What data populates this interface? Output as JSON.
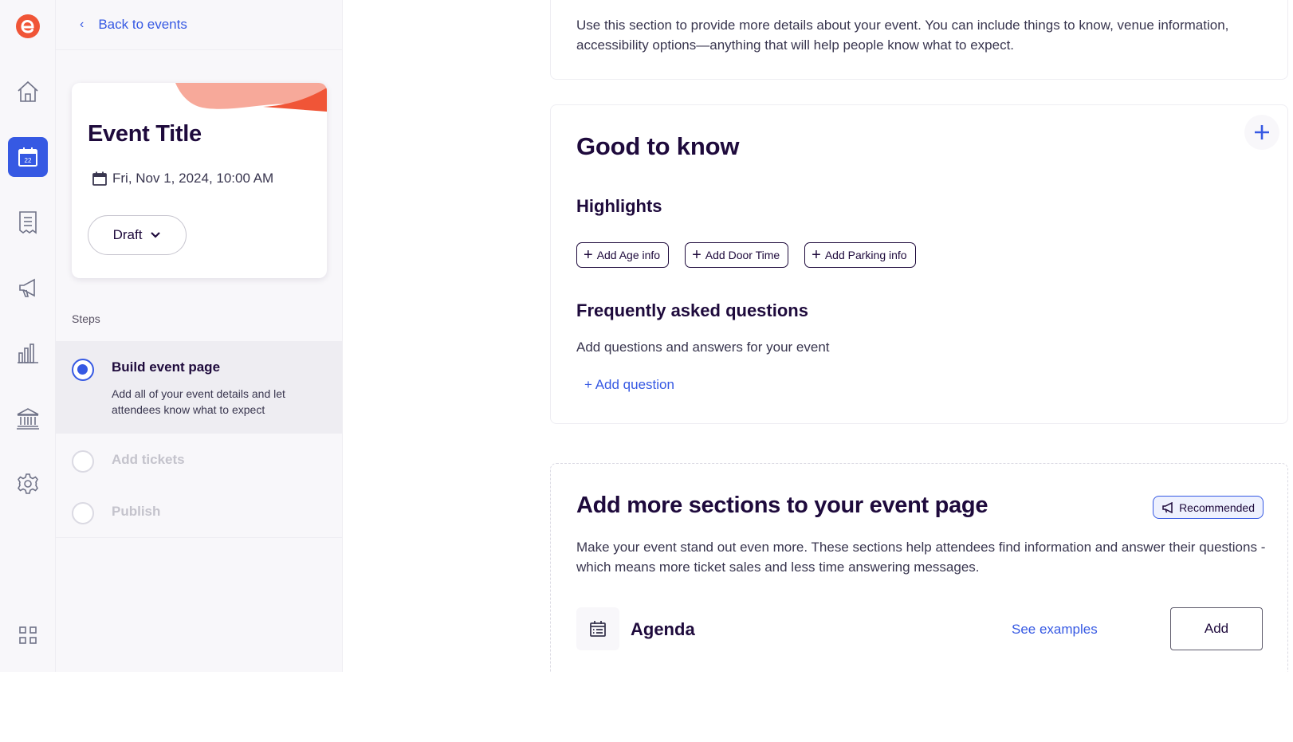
{
  "nav": {
    "back_label": "Back to events",
    "calendar_day": "22",
    "icons": [
      "logo-icon",
      "home-icon",
      "calendar-icon",
      "orders-icon",
      "marketing-icon",
      "reports-icon",
      "finance-icon",
      "settings-icon",
      "apps-grid-icon"
    ]
  },
  "event_card": {
    "title": "Event Title",
    "date": "Fri, Nov 1, 2024, 10:00 AM",
    "status": "Draft"
  },
  "steps": {
    "label": "Steps",
    "items": [
      {
        "name": "Build event page",
        "desc": "Add all of your event details and let attendees know what to expect"
      },
      {
        "name": "Add tickets"
      },
      {
        "name": "Publish"
      }
    ]
  },
  "overview": {
    "text": "Use this section to provide more details about your event. You can include things to know, venue information, accessibility options—anything that will help people know what to expect."
  },
  "good_to_know": {
    "title": "Good to know",
    "highlights_label": "Highlights",
    "chips": [
      "Add Age info",
      "Add Door Time",
      "Add Parking info"
    ],
    "faq_label": "Frequently asked questions",
    "faq_desc": "Add questions and answers for your event",
    "add_question": "+ Add question"
  },
  "more_sections": {
    "title": "Add more sections to your event page",
    "badge": "Recommended",
    "desc": "Make your event stand out even more. These sections help attendees find information and answer their questions -which means more ticket sales and less time answering messages.",
    "agenda": {
      "name": "Agenda",
      "see_examples": "See examples",
      "add": "Add"
    }
  },
  "colors": {
    "accent": "#3659e3",
    "brand": "#f05537",
    "text": "#1e0a3c"
  }
}
